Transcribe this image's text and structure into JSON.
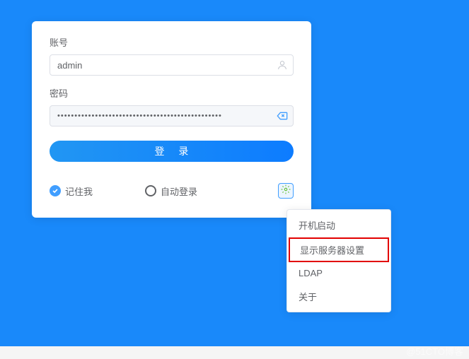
{
  "labels": {
    "account": "账号",
    "password": "密码"
  },
  "inputs": {
    "account_value": "admin",
    "password_mask": "••••••••••••••••••••••••••••••••••••••••••••••••"
  },
  "buttons": {
    "login": "登 录"
  },
  "options": {
    "remember": "记住我",
    "auto_login": "自动登录"
  },
  "menu": {
    "item1": "开机启动",
    "item2": "显示服务器设置",
    "item3": "LDAP",
    "item4": "关于"
  },
  "watermark": "@51CTO博客"
}
